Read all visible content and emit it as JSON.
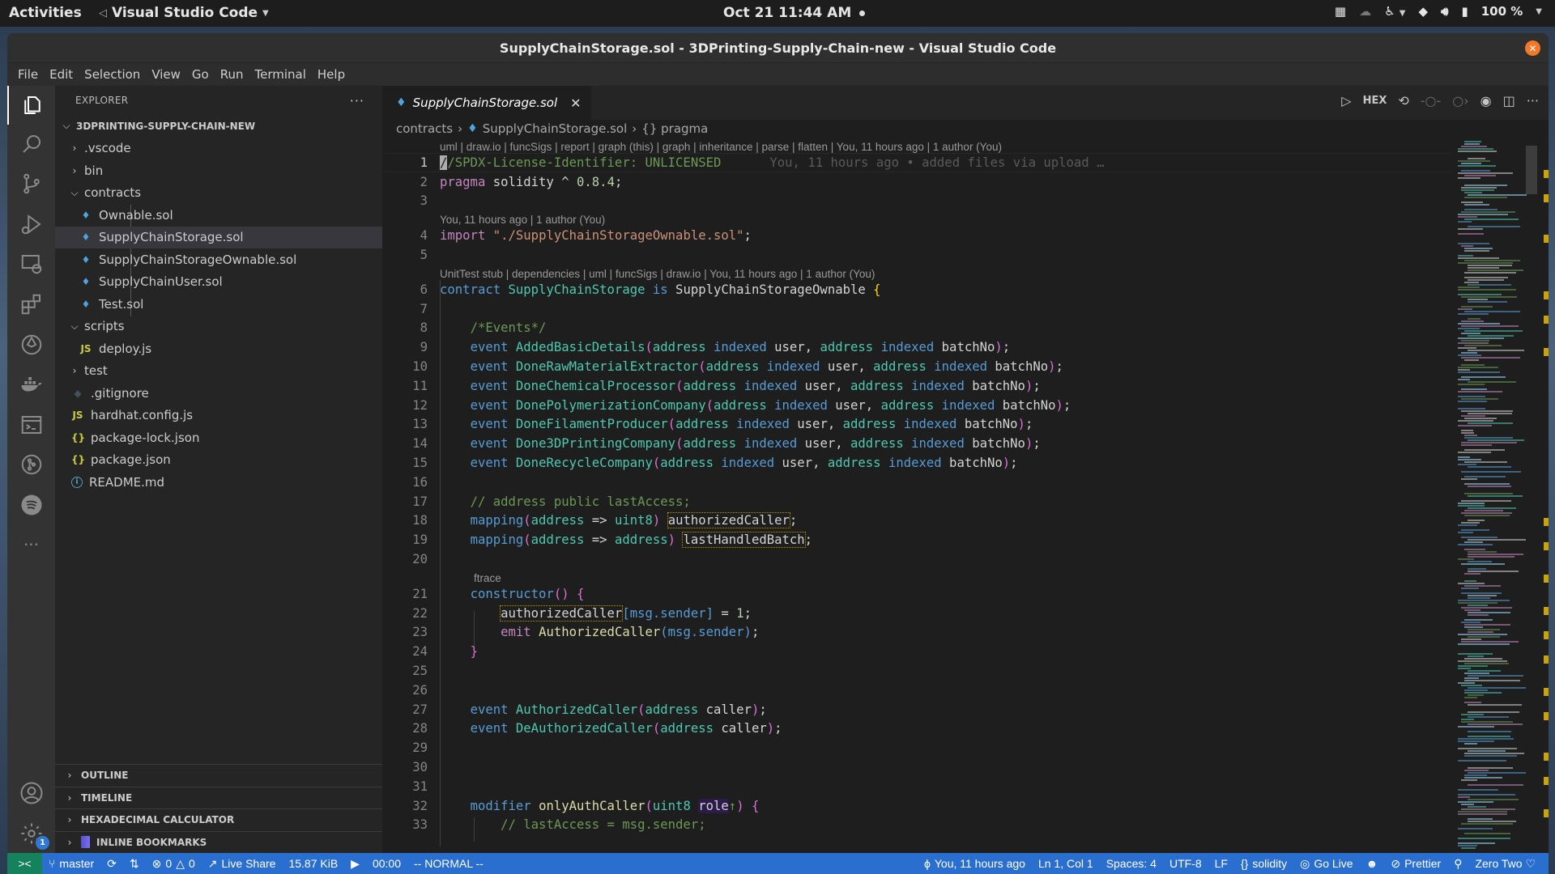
{
  "topbar": {
    "activities": "Activities",
    "app_name": "Visual Studio Code",
    "datetime": "Oct 21  11:44 AM",
    "battery": "100 %"
  },
  "window": {
    "title": "SupplyChainStorage.sol - 3DPrinting-Supply-Chain-new - Visual Studio Code"
  },
  "menu": [
    "File",
    "Edit",
    "Selection",
    "View",
    "Go",
    "Run",
    "Terminal",
    "Help"
  ],
  "activitybar": {
    "icons": [
      "explorer-icon",
      "search-icon",
      "source-control-icon",
      "run-debug-icon",
      "remote-explorer-icon",
      "extensions-icon",
      "ethereum-icon",
      "docker-icon",
      "terminal-icon",
      "git-graph-icon",
      "spotify-icon",
      "more-icon"
    ],
    "bottom_icons": [
      "account-icon",
      "settings-icon"
    ],
    "settings_badge": "1"
  },
  "sidebar": {
    "title": "EXPLORER",
    "root": "3DPRINTING-SUPPLY-CHAIN-NEW",
    "tree": [
      {
        "name": ".vscode",
        "type": "folder",
        "expanded": false,
        "depth": 1
      },
      {
        "name": "bin",
        "type": "folder",
        "expanded": false,
        "depth": 1
      },
      {
        "name": "contracts",
        "type": "folder",
        "expanded": true,
        "depth": 1
      },
      {
        "name": "Ownable.sol",
        "type": "sol",
        "depth": 2
      },
      {
        "name": "SupplyChainStorage.sol",
        "type": "sol",
        "depth": 2,
        "selected": true
      },
      {
        "name": "SupplyChainStorageOwnable.sol",
        "type": "sol",
        "depth": 2
      },
      {
        "name": "SupplyChainUser.sol",
        "type": "sol",
        "depth": 2
      },
      {
        "name": "Test.sol",
        "type": "sol",
        "depth": 2
      },
      {
        "name": "scripts",
        "type": "folder",
        "expanded": true,
        "depth": 1
      },
      {
        "name": "deploy.js",
        "type": "js",
        "depth": 2
      },
      {
        "name": "test",
        "type": "folder",
        "expanded": false,
        "depth": 1
      },
      {
        "name": ".gitignore",
        "type": "git",
        "depth": 1
      },
      {
        "name": "hardhat.config.js",
        "type": "js",
        "depth": 1
      },
      {
        "name": "package-lock.json",
        "type": "json",
        "depth": 1
      },
      {
        "name": "package.json",
        "type": "json",
        "depth": 1
      },
      {
        "name": "README.md",
        "type": "info",
        "depth": 1
      }
    ],
    "panels": [
      "OUTLINE",
      "TIMELINE",
      "HEXADECIMAL CALCULATOR",
      "INLINE BOOKMARKS"
    ]
  },
  "editor": {
    "tab": "SupplyChainStorage.sol",
    "actions": [
      "run-icon",
      "HEX",
      "go-back-icon",
      "commit-icon",
      "go-forward-icon",
      "git-lens-icon",
      "split-editor-icon",
      "more-actions-icon"
    ],
    "breadcrumb": [
      "contracts",
      "SupplyChainStorage.sol",
      "{} pragma"
    ],
    "codelens": {
      "l1": "uml | draw.io | funcSigs | report | graph (this) | graph | inheritance | parse | flatten | You, 11 hours ago | 1 author (You)",
      "l4": "You, 11 hours ago | 1 author (You)",
      "l6": "UnitTest stub | dependencies | uml | funcSigs | draw.io | You, 11 hours ago | 1 author (You)",
      "l21": "ftrace"
    },
    "blame": "You, 11 hours ago • added files via upload …"
  },
  "statusbar": {
    "branch": "master",
    "errors": "0",
    "warnings": "0",
    "live_share": "Live Share",
    "file_size": "15.87 KiB",
    "timer": "00:00",
    "vim_mode": "-- NORMAL --",
    "blame": "You, 11 hours ago",
    "position": "Ln 1, Col 1",
    "spaces": "Spaces: 4",
    "encoding": "UTF-8",
    "eol": "LF",
    "language": "solidity",
    "go_live": "Go Live",
    "prettier": "Prettier",
    "theme": "Zero Two ♡"
  }
}
